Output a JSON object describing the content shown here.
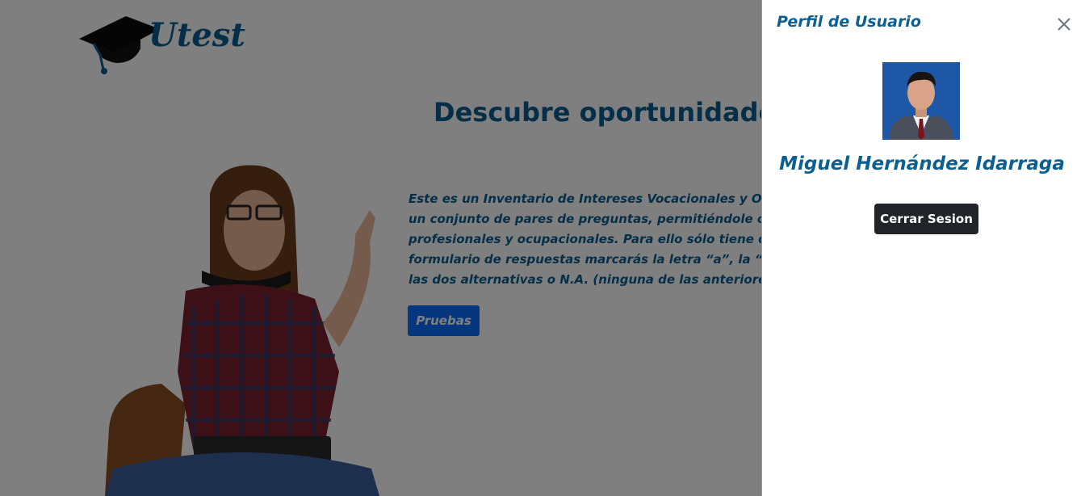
{
  "brand": {
    "logo_text": "Utest",
    "logo_icon": "graduation-cap-icon",
    "color": "#0b5f91"
  },
  "hero": {
    "title": "Descubre oportunidades d",
    "paragraph_lines": [
      "Este es un Inventario de Intereses Vocacionales y Ocupaci",
      "un conjunto de pares de preguntas, permitiéndole obten",
      "profesionales y ocupacionales. Para ello sólo tiene que el",
      "formulario de respuestas marcarás la letra “a”, la “b”, am",
      "las dos alternativas o N.A. (ninguna de las anteriores), seg"
    ],
    "tests_button": "Pruebas"
  },
  "profile_panel": {
    "title": "Perfil de Usuario",
    "close_icon": "close-icon",
    "user_name": "Miguel Hernández Idarraga",
    "logout_button": "Cerrar Sesion"
  },
  "colors": {
    "primary": "#0d6efd",
    "dark": "#212529",
    "overlay": "rgba(0,0,0,0.5)"
  }
}
